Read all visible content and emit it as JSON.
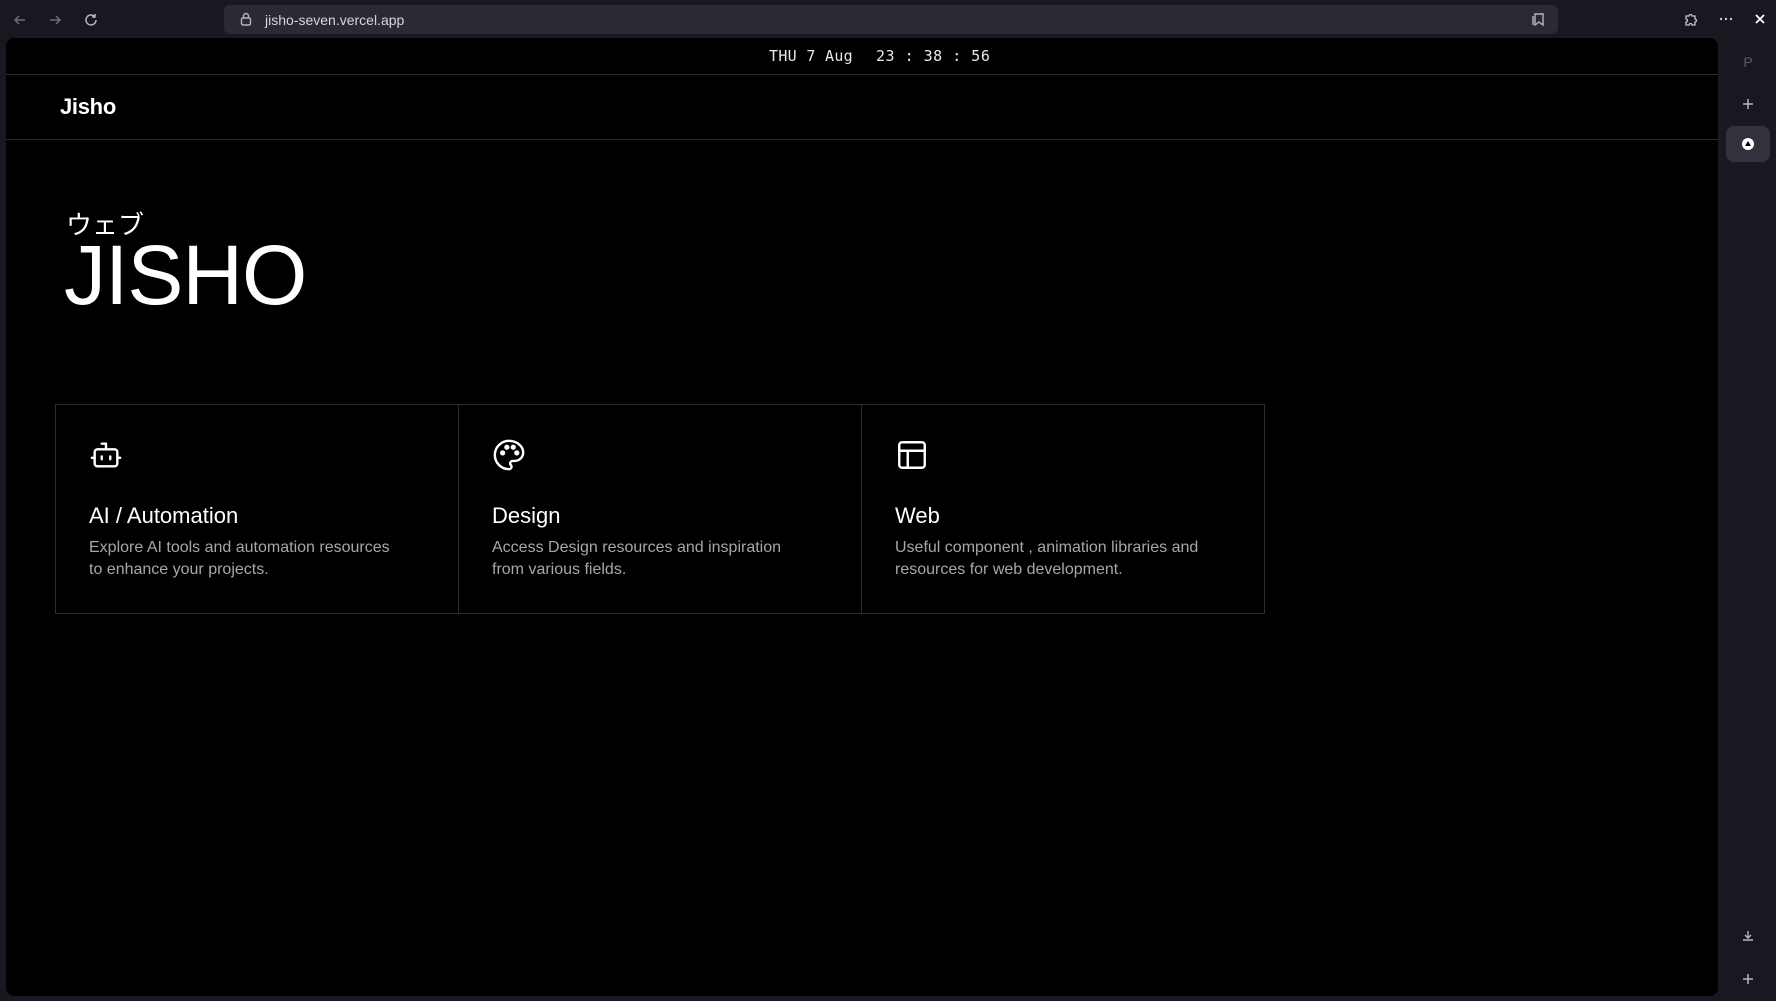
{
  "browser": {
    "url": "jisho-seven.vercel.app",
    "back_icon": "arrow-left-icon",
    "forward_icon": "arrow-right-icon",
    "reload_icon": "reload-icon",
    "lock_icon": "lock-icon",
    "bookmark_icon": "bookmark-icon",
    "extensions_icon": "puzzle-icon",
    "menu_icon": "more-horizontal-icon",
    "close_icon": "close-icon"
  },
  "sidebar": {
    "profile_label": "P",
    "items": [
      {
        "icon": "plus-icon"
      },
      {
        "icon": "up-triangle-icon"
      },
      {
        "icon": "download-icon"
      },
      {
        "icon": "plus-icon"
      }
    ]
  },
  "clock": {
    "date": "THU 7 Aug",
    "time": "23 : 38 : 56"
  },
  "header": {
    "logo": "Jisho"
  },
  "hero": {
    "kana": "ウェブ",
    "title": "JISHO"
  },
  "cards": [
    {
      "icon": "robot-icon",
      "title": "AI / Automation",
      "description": "Explore AI tools and automation resources to enhance your projects."
    },
    {
      "icon": "palette-icon",
      "title": "Design",
      "description": "Access Design resources and inspiration from various fields."
    },
    {
      "icon": "layout-icon",
      "title": "Web",
      "description": "Useful component , animation libraries and resources for web development."
    }
  ],
  "colors": {
    "chrome_bg": "#1b1721",
    "page_bg": "#000000",
    "text_primary": "#ffffff",
    "text_secondary": "#a7a7a7",
    "border": "#2e2e2e"
  }
}
